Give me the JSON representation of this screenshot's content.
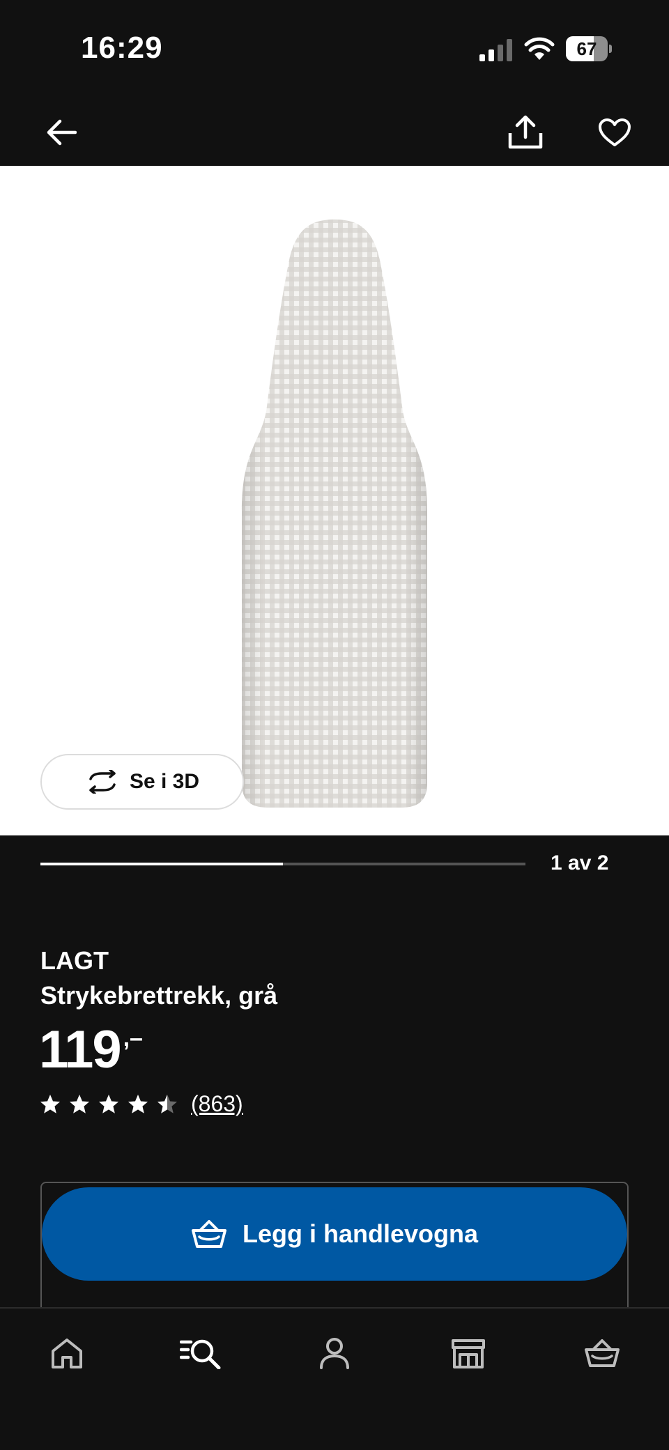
{
  "status_bar": {
    "time": "16:29",
    "battery_level": "67",
    "battery_fraction": 0.67,
    "signal_bars_active": 2,
    "icons": [
      "cellular-signal-icon",
      "wifi-icon",
      "battery-icon"
    ]
  },
  "header": {
    "icons": [
      "arrow-left-icon",
      "share-icon",
      "heart-icon"
    ]
  },
  "gallery": {
    "view_3d_label": "Se i 3D",
    "view_3d_icon": "rotate-3d-icon",
    "page_counter": "1 av 2",
    "progress_fraction": 0.5
  },
  "product": {
    "name": "LAGT",
    "description": "Strykebrettrekk, grå",
    "price": "119",
    "price_suffix": ",–",
    "rating": 4.5,
    "review_count": "(863)"
  },
  "cart_button": {
    "label": "Legg i handlevogna",
    "icon": "shopping-basket-icon",
    "color": "#0058a3"
  },
  "bottom_nav": {
    "items": [
      {
        "icon": "home-icon"
      },
      {
        "icon": "search-list-icon"
      },
      {
        "icon": "profile-icon"
      },
      {
        "icon": "store-icon"
      },
      {
        "icon": "shopping-basket-icon"
      }
    ]
  }
}
